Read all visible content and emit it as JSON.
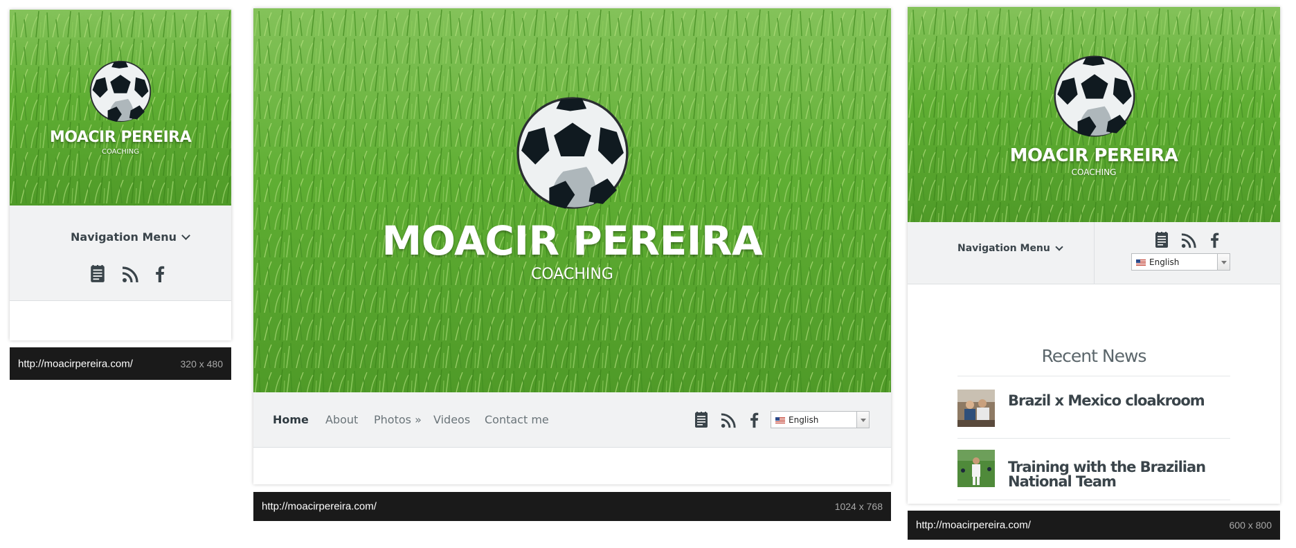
{
  "brand": {
    "name": "MOACIR PEREIRA",
    "tagline": "COACHING"
  },
  "nav": {
    "menu_label": "Navigation Menu",
    "items": [
      "Home",
      "About",
      "Photos »",
      "Videos",
      "Contact me"
    ],
    "active": "Home"
  },
  "social_icons": [
    "blog-icon",
    "rss-icon",
    "facebook-icon"
  ],
  "language": {
    "selected": "English"
  },
  "news": {
    "heading": "Recent News",
    "items": [
      {
        "title": "Brazil x Mexico cloakroom"
      },
      {
        "title": "Training with the Brazilian National Team"
      }
    ]
  },
  "devices": [
    {
      "url": "http://moacirpereira.com/",
      "dimensions": "320 x 480"
    },
    {
      "url": "http://moacirpereira.com/",
      "dimensions": "1024 x 768"
    },
    {
      "url": "http://moacirpereira.com/",
      "dimensions": "600 x 800"
    }
  ],
  "colors": {
    "grass": "#5ea832",
    "nav_bar": "#f1f2f3",
    "text_dark": "#2f3a40",
    "url_bar": "#1a1a1a"
  }
}
